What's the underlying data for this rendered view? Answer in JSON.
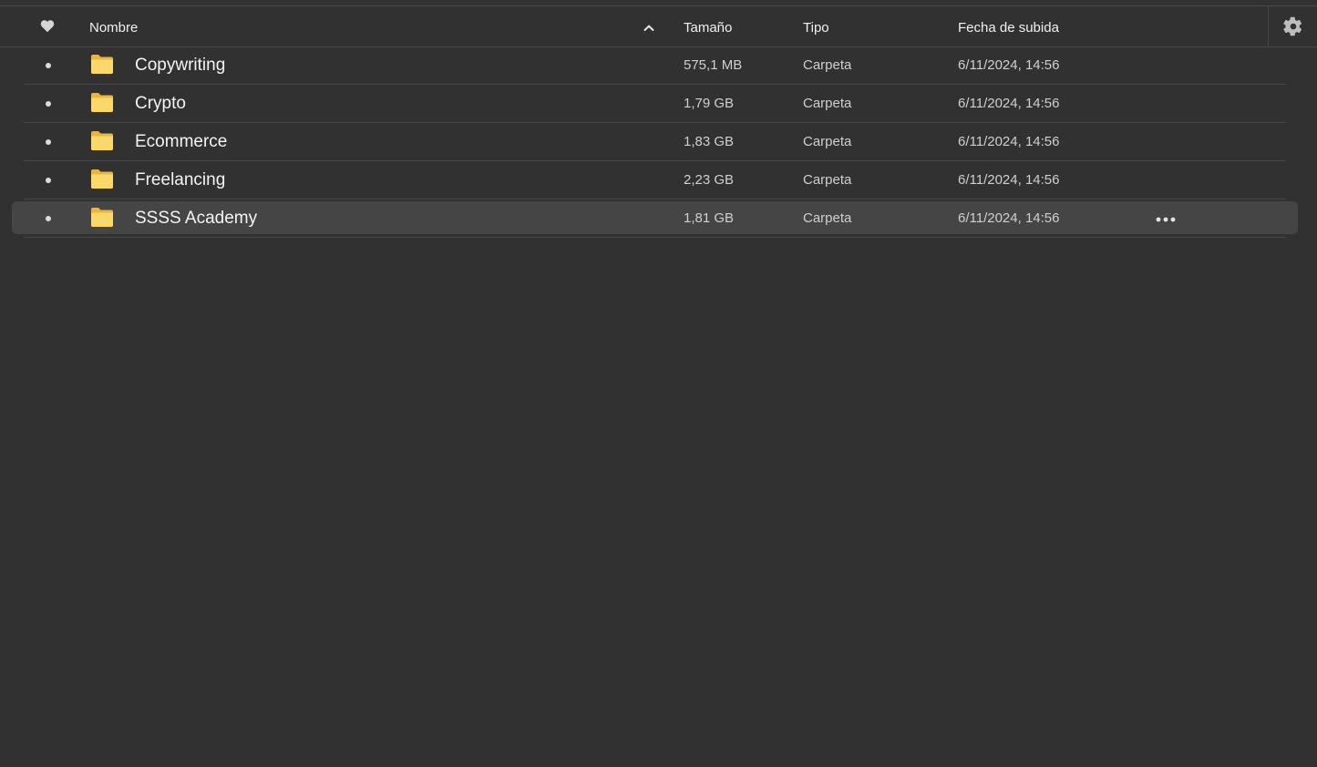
{
  "header": {
    "name_label": "Nombre",
    "size_label": "Tamaño",
    "type_label": "Tipo",
    "date_label": "Fecha de subida"
  },
  "icons": {
    "favorite": "heart-icon",
    "sort": "chevron-up-icon",
    "settings": "gear-icon",
    "folder": "folder-icon",
    "more": "more-horizontal-icon"
  },
  "colors": {
    "background": "#313131",
    "selected_row": "#454545",
    "folder": "#f6cd55",
    "text": "#f4f4f4",
    "muted_text": "#cfcfcf"
  },
  "files": [
    {
      "name": "Copywriting",
      "size": "575,1 MB",
      "type": "Carpeta",
      "date": "6/11/2024, 14:56",
      "selected": false
    },
    {
      "name": "Crypto",
      "size": "1,79 GB",
      "type": "Carpeta",
      "date": "6/11/2024, 14:56",
      "selected": false
    },
    {
      "name": "Ecommerce",
      "size": "1,83 GB",
      "type": "Carpeta",
      "date": "6/11/2024, 14:56",
      "selected": false
    },
    {
      "name": "Freelancing",
      "size": "2,23 GB",
      "type": "Carpeta",
      "date": "6/11/2024, 14:56",
      "selected": false
    },
    {
      "name": "SSSS Academy",
      "size": "1,81 GB",
      "type": "Carpeta",
      "date": "6/11/2024, 14:56",
      "selected": true
    }
  ]
}
